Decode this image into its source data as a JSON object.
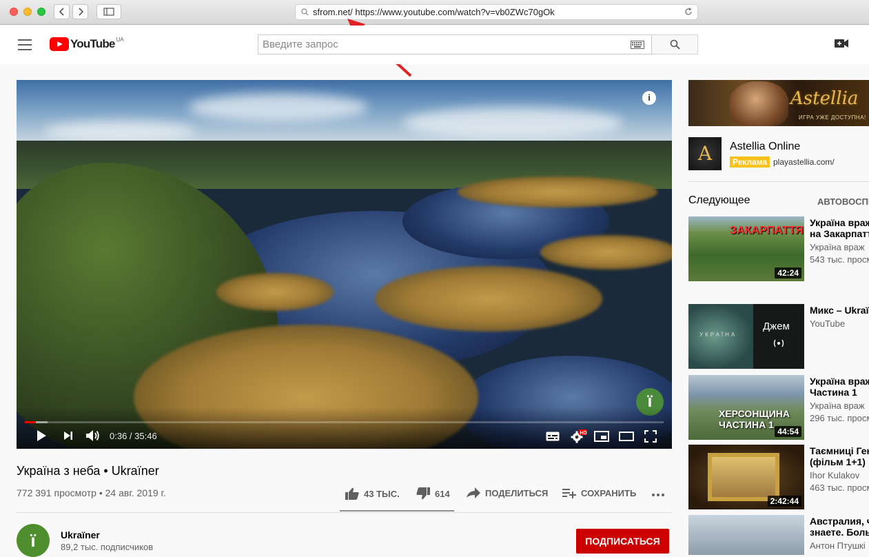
{
  "browser": {
    "address_prefix": "sfrom.net/",
    "address_url": "https://www.youtube.com/watch?v=vb0ZWc70gOk"
  },
  "masthead": {
    "logo": "YouTube",
    "region": "UA",
    "search_placeholder": "Введите запрос"
  },
  "player": {
    "time": "0:36 / 35:46",
    "progress_played": 0.017,
    "progress_loaded": 0.036,
    "watermark": "ї"
  },
  "video": {
    "title": "Україна з неба • Ukraїner",
    "views": "772 391 просмотр • 24 авг. 2019 г.",
    "likes": "43 ТЫС.",
    "dislikes": "614",
    "share": "ПОДЕЛИТЬСЯ",
    "save": "СОХРАНИТЬ"
  },
  "channel": {
    "name": "Ukraїner",
    "subs": "89,2 тыс. подписчиков",
    "avatar": "ї",
    "subscribe": "ПОДПИСАТЬСЯ"
  },
  "ad": {
    "logo": "Astellia",
    "tagline": "ИГРА УЖЕ ДОСТУПНА!",
    "name": "Astellia Online",
    "badge": "Реклама",
    "url": "playastellia.com/"
  },
  "sidebar": {
    "up_next": "Следующее",
    "autoplay": "АВТОВОСПР",
    "items": [
      {
        "title": "Україна враж",
        "title2": "на Закарпатт",
        "channel": "Україна враж",
        "views": "543 тыс. просм",
        "duration": "42:24",
        "thumb_text": "ЗАКАРПАТТЯ"
      },
      {
        "title": "Микс – Ukraï",
        "title2": "",
        "channel": "YouTube",
        "views": "",
        "duration": "",
        "thumb_text": "Джем",
        "thumb_sub": "УКРАЇНА"
      },
      {
        "title": "Україна враж",
        "title2": "Частина 1",
        "channel": "Україна враж",
        "views": "296 тыс. просм",
        "duration": "44:54",
        "thumb_text": "ХЕРСОНЩИНА ЧАСТИНА 1"
      },
      {
        "title": "Таємниці Ген",
        "title2": "(фільм 1+1)",
        "channel": "Ihor Kulakov",
        "views": "463 тыс. просм",
        "duration": "2:42:44",
        "thumb_text": ""
      },
      {
        "title": "Австралия, ч",
        "title2": "знаете. Боль",
        "channel": "Антон Птушкі",
        "views": "",
        "duration": "",
        "thumb_text": ""
      }
    ]
  }
}
